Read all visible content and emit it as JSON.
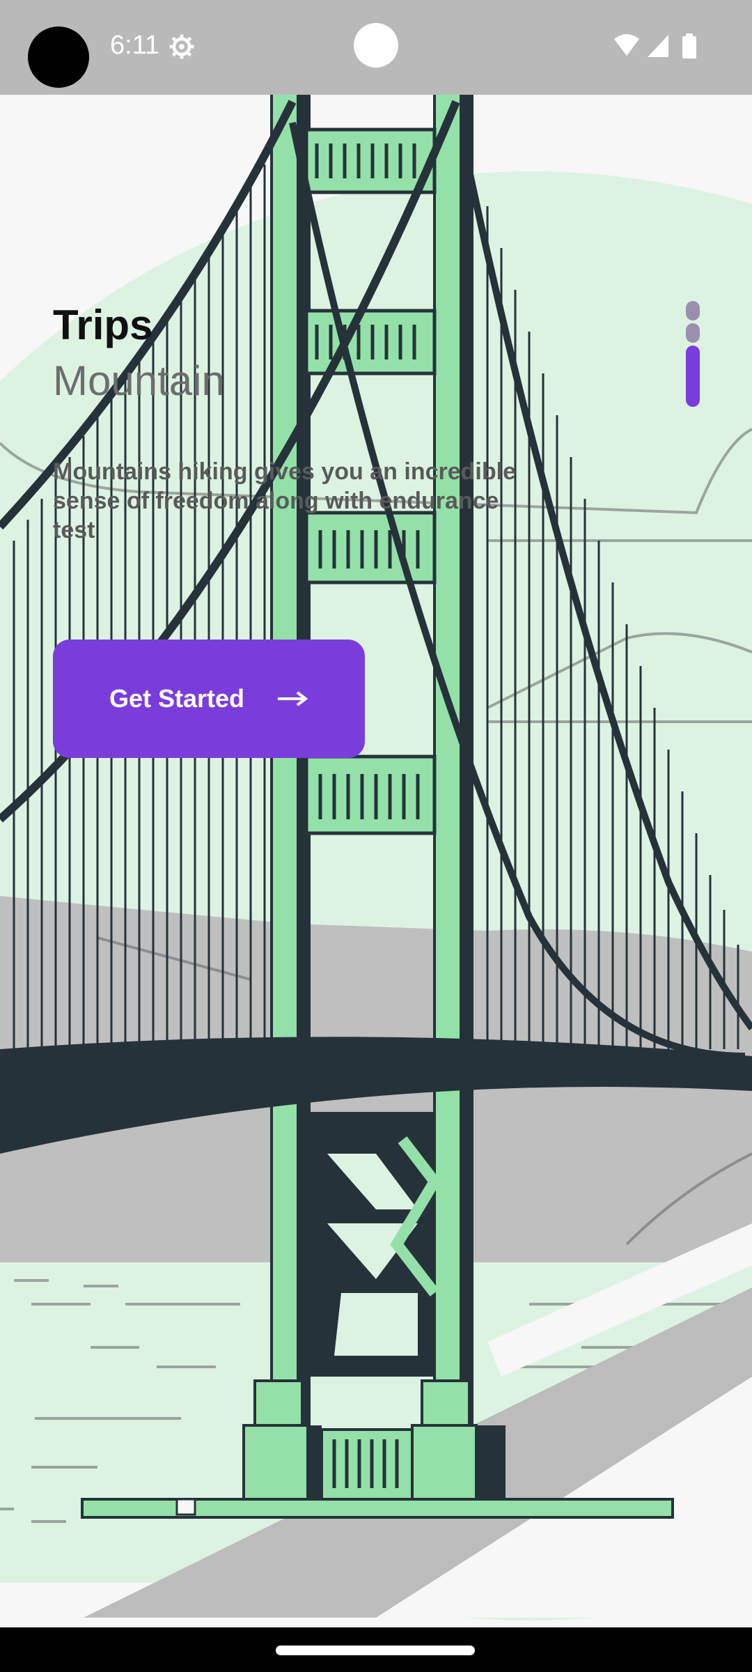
{
  "status_bar": {
    "time": "6:11",
    "icons": [
      "settings-icon",
      "wifi-icon",
      "signal-icon",
      "battery-icon"
    ]
  },
  "onboarding": {
    "title": "Trips",
    "subtitle": "Mountain",
    "description": "Mountains hiking gives you an incredible sense of freedom along with endurance test",
    "cta_label": "Get Started",
    "cta_icon": "arrow-right-icon",
    "page_indicator": {
      "count": 3,
      "active_index": 2
    }
  },
  "illustration": {
    "subject": "bridge-illustration",
    "colors": {
      "mint": "#dcf3e2",
      "tower_green": "#93e1a8",
      "dark": "#26323a",
      "hills": "#bfbfbf"
    }
  },
  "theme": {
    "accent": "#7a3ddb"
  }
}
